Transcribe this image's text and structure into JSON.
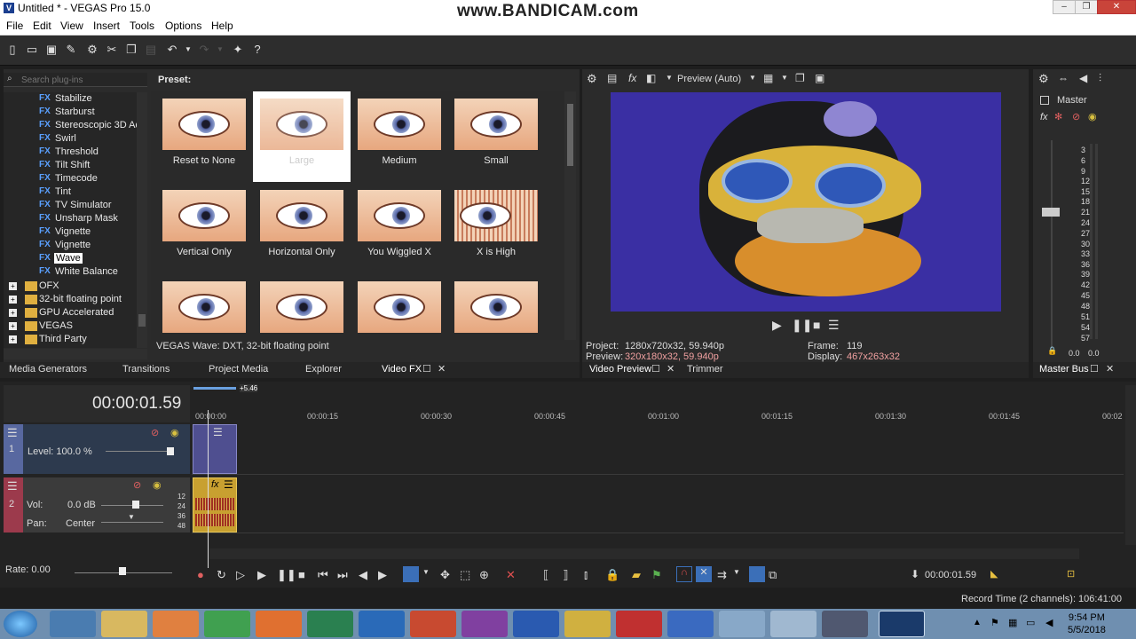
{
  "window": {
    "title": "Untitled * - VEGAS Pro 15.0",
    "watermark": "www.BANDICAM.com"
  },
  "menu": [
    "File",
    "Edit",
    "View",
    "Insert",
    "Tools",
    "Options",
    "Help"
  ],
  "plugins": {
    "search_placeholder": "Search plug-ins",
    "tree_fx": [
      "Stabilize",
      "Starburst",
      "Stereoscopic 3D Adj",
      "Swirl",
      "Threshold",
      "Tilt Shift",
      "Timecode",
      "Tint",
      "TV Simulator",
      "Unsharp Mask",
      "Vignette",
      "Vignette",
      "Wave",
      "White Balance"
    ],
    "selected": "Wave",
    "tree_folders": [
      "OFX",
      "32-bit floating point",
      "GPU Accelerated",
      "VEGAS",
      "Third Party"
    ],
    "preset_label": "Preset:",
    "presets": [
      "Reset to None",
      "Large",
      "Medium",
      "Small",
      "Vertical Only",
      "Horizontal Only",
      "You Wiggled X",
      "X is High",
      "",
      "",
      "",
      ""
    ],
    "selected_preset": "Large",
    "status": "VEGAS Wave: DXT, 32-bit floating point"
  },
  "tabs": {
    "left": [
      "Media Generators",
      "Transitions",
      "Project Media",
      "Explorer",
      "Video FX"
    ],
    "preview": [
      "Video Preview",
      "Trimmer"
    ],
    "master": "Master Bus"
  },
  "preview": {
    "mode": "Preview (Auto)",
    "project_label": "Project:",
    "project": "1280x720x32, 59.940p",
    "preview_label": "Preview:",
    "preview_res": "320x180x32, 59.940p",
    "frame_label": "Frame:",
    "frame": "119",
    "display_label": "Display:",
    "display": "467x263x32"
  },
  "master": {
    "label": "Master",
    "db_scale": [
      "3",
      "6",
      "9",
      "12",
      "15",
      "18",
      "21",
      "24",
      "27",
      "30",
      "33",
      "36",
      "39",
      "42",
      "45",
      "48",
      "51",
      "54",
      "57"
    ],
    "peaks": [
      "0.0",
      "0.0"
    ]
  },
  "timeline": {
    "timecode": "00:00:01.59",
    "marker": "+5.46",
    "ruler": [
      "00:00:00",
      "00:00:15",
      "00:00:30",
      "00:00:45",
      "00:01:00",
      "00:01:15",
      "00:01:30",
      "00:01:45",
      "00:02"
    ],
    "track1": {
      "number": "1",
      "level": "Level: 100.0 %"
    },
    "track2": {
      "number": "2",
      "vol_label": "Vol:",
      "vol": "0.0 dB",
      "pan_label": "Pan:",
      "pan": "Center",
      "scale": [
        "12",
        "24",
        "36",
        "48"
      ]
    },
    "rate": "Rate: 0.00",
    "cursor_time": "00:00:01.59",
    "record_time": "Record Time (2 channels): 106:41:00"
  },
  "clock": {
    "time": "9:54 PM",
    "date": "5/5/2018"
  }
}
